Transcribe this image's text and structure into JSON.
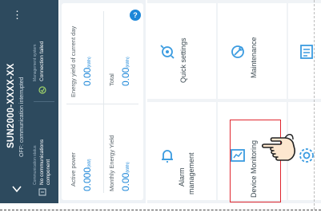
{
  "header": {
    "title": "SUN2000-XXXX-XX",
    "subtitle": "OFF: communication interrupted",
    "status_left": {
      "caption": "Communication status",
      "value_line1": "No communications",
      "value_line2": "component"
    },
    "status_right": {
      "caption": "Management system",
      "value": "Connection failed"
    },
    "accent": "#2d4a5e"
  },
  "energy": {
    "active_power": {
      "label": "Active power",
      "value": "0.000",
      "unit": "(kW)"
    },
    "monthly_yield": {
      "label": "Monthly Energy Yield",
      "value": "0.00",
      "unit": "(kWh)"
    },
    "daily_yield": {
      "label": "Energy yield of current day",
      "value": "0.00",
      "unit": "(kWh)"
    },
    "total": {
      "label": "Total",
      "value": "0.00",
      "unit": "(kWh)"
    },
    "value_color": "#1d87d8"
  },
  "tiles": {
    "alarm": {
      "label_line1": "Alarm",
      "label_line2": "management",
      "icon": "alarm-icon"
    },
    "quick": {
      "label": "Quick settings",
      "icon": "quick-settings-icon"
    },
    "device_monitoring": {
      "label": "Device Monitoring",
      "icon": "device-monitoring-icon"
    },
    "maintenance": {
      "label": "Maintenance",
      "icon": "maintenance-icon"
    },
    "settings": {
      "icon": "settings-icon"
    },
    "log": {
      "icon": "log-icon"
    }
  },
  "highlight_color": "#e0262e"
}
